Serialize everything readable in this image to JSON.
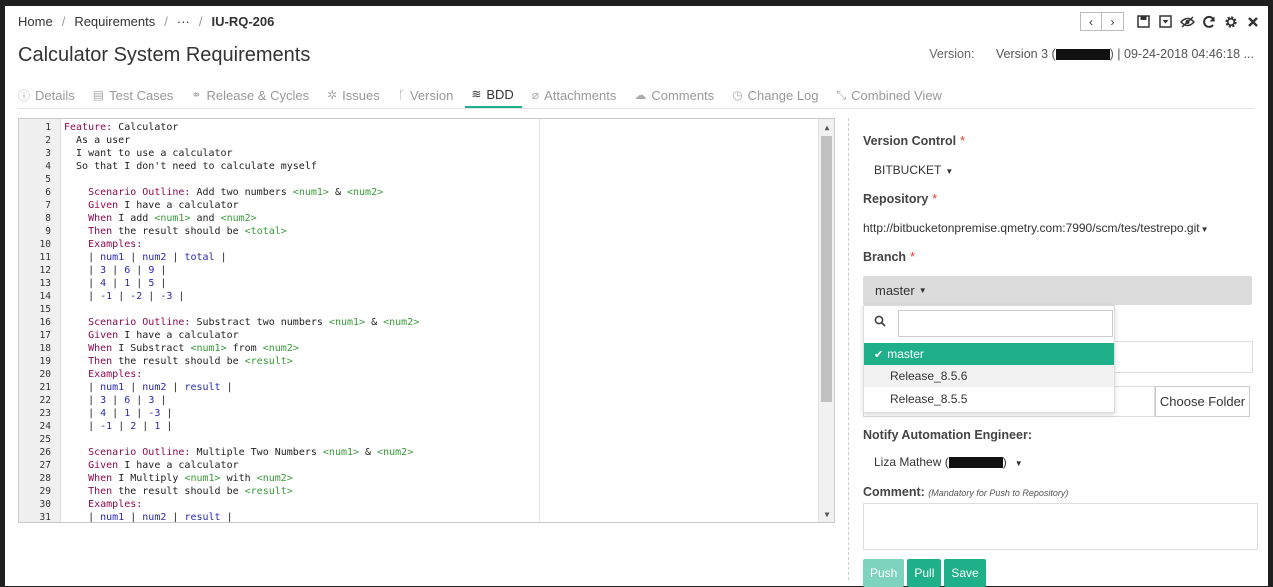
{
  "breadcrumb": {
    "home": "Home",
    "requirements": "Requirements",
    "ellipsis": "···",
    "current": "IU-RQ-206"
  },
  "toolbar": {
    "prev": "‹",
    "next": "›",
    "icons": [
      "save-icon",
      "download-icon",
      "hide-icon",
      "refresh-icon",
      "gear-icon",
      "close-icon"
    ]
  },
  "header": {
    "title": "Calculator System Requirements",
    "version_label": "Version:",
    "version_value": "Version 3 (",
    "version_date": ") | 09-24-2018 04:46:18 ..."
  },
  "tabs": [
    {
      "label": "Details",
      "icon": "info-icon"
    },
    {
      "label": "Test Cases",
      "icon": "document-icon"
    },
    {
      "label": "Release & Cycles",
      "icon": "link-icon"
    },
    {
      "label": "Issues",
      "icon": "bug-icon"
    },
    {
      "label": "Version",
      "icon": "branch-icon"
    },
    {
      "label": "BDD",
      "icon": "database-icon",
      "active": true
    },
    {
      "label": "Attachments",
      "icon": "paperclip-icon"
    },
    {
      "label": "Comments",
      "icon": "comments-icon"
    },
    {
      "label": "Change Log",
      "icon": "clock-icon"
    },
    {
      "label": "Combined View",
      "icon": "compress-icon"
    }
  ],
  "editor": {
    "lines": [
      "Feature: Calculator",
      "  As a user",
      "  I want to use a calculator",
      "  So that I don't need to calculate myself",
      "",
      "    Scenario Outline: Add two numbers <num1> & <num2>",
      "    Given I have a calculator",
      "    When I add <num1> and <num2>",
      "    Then the result should be <total>",
      "    Examples:",
      "    | num1 | num2 | total |",
      "    | 3 | 6 | 9 |",
      "    | 4 | 1 | 5 |",
      "    | -1 | -2 | -3 |",
      "",
      "    Scenario Outline: Substract two numbers <num1> & <num2>",
      "    Given I have a calculator",
      "    When I Substract <num1> from <num2>",
      "    Then the result should be <result>",
      "    Examples:",
      "    | num1 | num2 | result |",
      "    | 3 | 6 | 3 |",
      "    | 4 | 1 | -3 |",
      "    | -1 | 2 | 1 |",
      "",
      "    Scenario Outline: Multiple Two Numbers <num1> & <num2>",
      "    Given I have a calculator",
      "    When I Multiply <num1> with <num2>",
      "    Then the result should be <result>",
      "    Examples:",
      "    | num1 | num2 | result |"
    ]
  },
  "panel": {
    "version_control_label": "Version Control",
    "version_control_value": "BITBUCKET",
    "repository_label": "Repository",
    "repository_value": "http://bitbucketonpremise.qmetry.com:7990/scm/tes/testrepo.git",
    "branch_label": "Branch",
    "branch_value": "master",
    "branch_options": [
      "master",
      "Release_8.5.6",
      "Release_8.5.5"
    ],
    "choose_folder": "Choose Folder",
    "notify_label": "Notify Automation Engineer:",
    "notify_value_prefix": "Liza Mathew (",
    "notify_value_suffix": ")",
    "comment_label": "Comment:",
    "comment_hint": "(Mandatory for Push to Repository)",
    "required_mark": "*",
    "buttons": {
      "push": "Push",
      "pull": "Pull",
      "save": "Save"
    },
    "colors": {
      "accent": "#1fb08a",
      "push_disabled": "#7dd3bd",
      "required": "#e53935"
    }
  }
}
